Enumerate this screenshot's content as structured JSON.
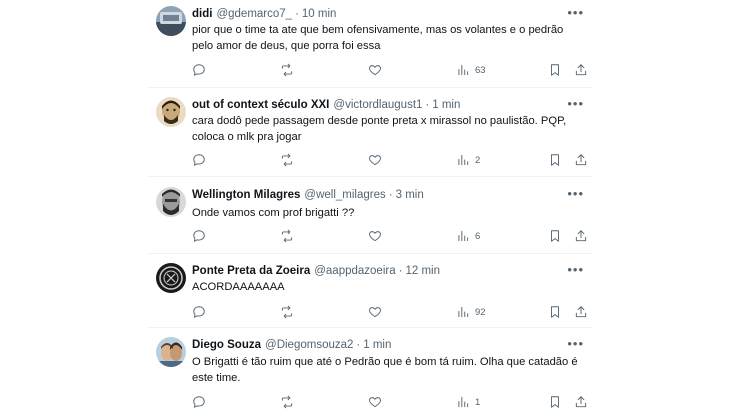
{
  "tweets": [
    {
      "name": "didi",
      "handle": "@gdemarco7_",
      "time": "10 min",
      "text": "pior que o time ta ate que bem ofensivamente, mas os volantes e o pedrão pelo amor de deus, que porra foi essa",
      "views": "63",
      "avatar_colors": [
        "#8fa3b8",
        "#3f4e5e"
      ]
    },
    {
      "name": "out of context século XXI",
      "handle": "@victordlaugust1",
      "time": "1 min",
      "text": "cara dodô pede passagem desde ponte preta x mirassol no paulistão. PQP, coloca o mlk pra jogar",
      "views": "2",
      "avatar_colors": [
        "#c9a97a",
        "#3a2a1c"
      ]
    },
    {
      "name": "Wellington Milagres",
      "handle": "@well_milagres",
      "time": "3 min",
      "text": "Onde vamos com prof brigatti ??",
      "views": "6",
      "avatar_colors": [
        "#d8d8d8",
        "#2b2b2b"
      ]
    },
    {
      "name": "Ponte Preta da Zoeira",
      "handle": "@aappdazoeira",
      "time": "12 min",
      "text": "ACORDAAAAAAA",
      "views": "92",
      "avatar_colors": [
        "#1a1a1a",
        "#cfcfcf"
      ]
    },
    {
      "name": "Diego Souza",
      "handle": "@Diegomsouza2",
      "time": "1 min",
      "text": "O Brigatti é tão ruim que até o Pedrão que é bom tá ruim. Olha que catadão é este time.",
      "views": "1",
      "avatar_colors": [
        "#d9b48f",
        "#5a3d28"
      ]
    }
  ],
  "icons": {
    "reply": "reply-icon",
    "retweet": "retweet-icon",
    "like": "heart-icon",
    "views": "views-icon",
    "bookmark": "bookmark-icon",
    "share": "share-icon",
    "more": "more-icon"
  },
  "more_glyph": "•••"
}
